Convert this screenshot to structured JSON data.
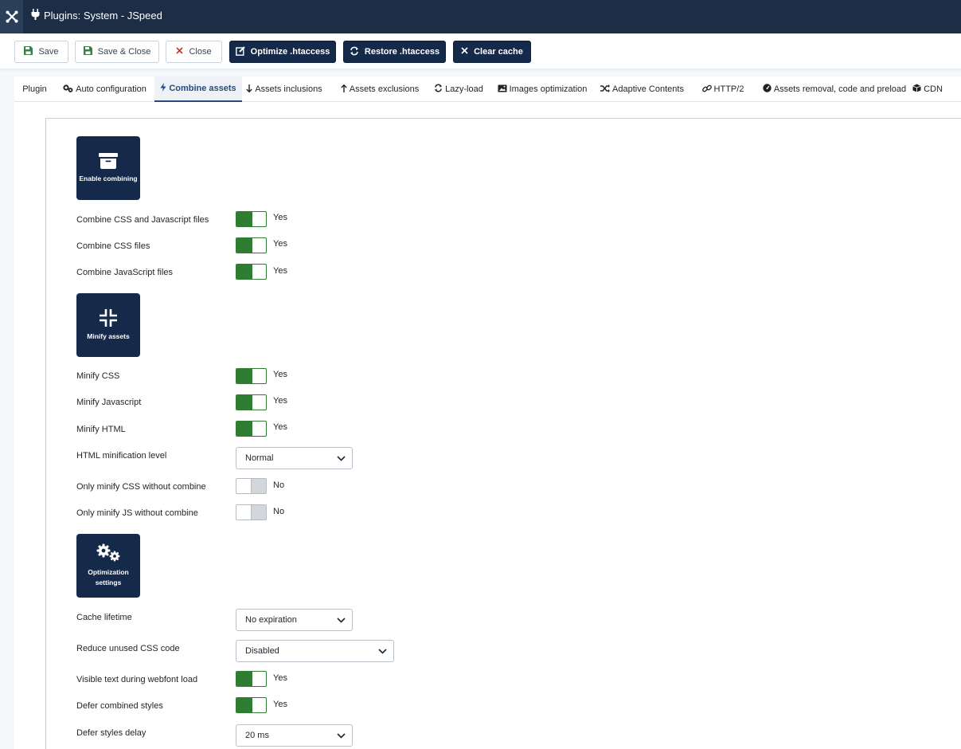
{
  "header": {
    "title": "Plugins: System - JSpeed"
  },
  "toolbar": {
    "save": "Save",
    "save_close": "Save & Close",
    "close": "Close",
    "optimize": "Optimize .htaccess",
    "restore": "Restore .htaccess",
    "clear_cache": "Clear cache"
  },
  "tabs": [
    "Plugin",
    "Auto configuration",
    "Combine assets",
    "Assets inclusions",
    "Assets exclusions",
    "Lazy-load",
    "Images optimization",
    "Adaptive Contents",
    "HTTP/2",
    "Assets removal, code and preload",
    "CDN"
  ],
  "active_tab": "Combine assets",
  "sections": {
    "combine": {
      "title": "Enable combining"
    },
    "minify": {
      "title": "Minify assets"
    },
    "optimization": {
      "title_line1": "Optimization",
      "title_line2": "settings"
    }
  },
  "fields": {
    "combine_css_js": {
      "label": "Combine CSS and Javascript files",
      "value": "Yes"
    },
    "combine_css": {
      "label": "Combine CSS files",
      "value": "Yes"
    },
    "combine_js": {
      "label": "Combine JavaScript files",
      "value": "Yes"
    },
    "minify_css": {
      "label": "Minify CSS",
      "value": "Yes"
    },
    "minify_js": {
      "label": "Minify Javascript",
      "value": "Yes"
    },
    "minify_html": {
      "label": "Minify HTML",
      "value": "Yes"
    },
    "html_level": {
      "label": "HTML minification level",
      "value": "Normal"
    },
    "only_minify_css": {
      "label": "Only minify CSS without combine",
      "value": "No"
    },
    "only_minify_js": {
      "label": "Only minify JS without combine",
      "value": "No"
    },
    "cache_lifetime": {
      "label": "Cache lifetime",
      "value": "No expiration"
    },
    "reduce_unused_css": {
      "label": "Reduce unused CSS code",
      "value": "Disabled"
    },
    "visible_text": {
      "label": "Visible text during webfont load",
      "value": "Yes"
    },
    "defer_styles": {
      "label": "Defer combined styles",
      "value": "Yes"
    },
    "defer_delay": {
      "label": "Defer styles delay",
      "value": "20 ms"
    }
  },
  "colors": {
    "header_bg": "#1c2d45",
    "primary_dark": "#15294a",
    "toggle_on": "#2e7d32",
    "close_icon": "#c0392b"
  }
}
